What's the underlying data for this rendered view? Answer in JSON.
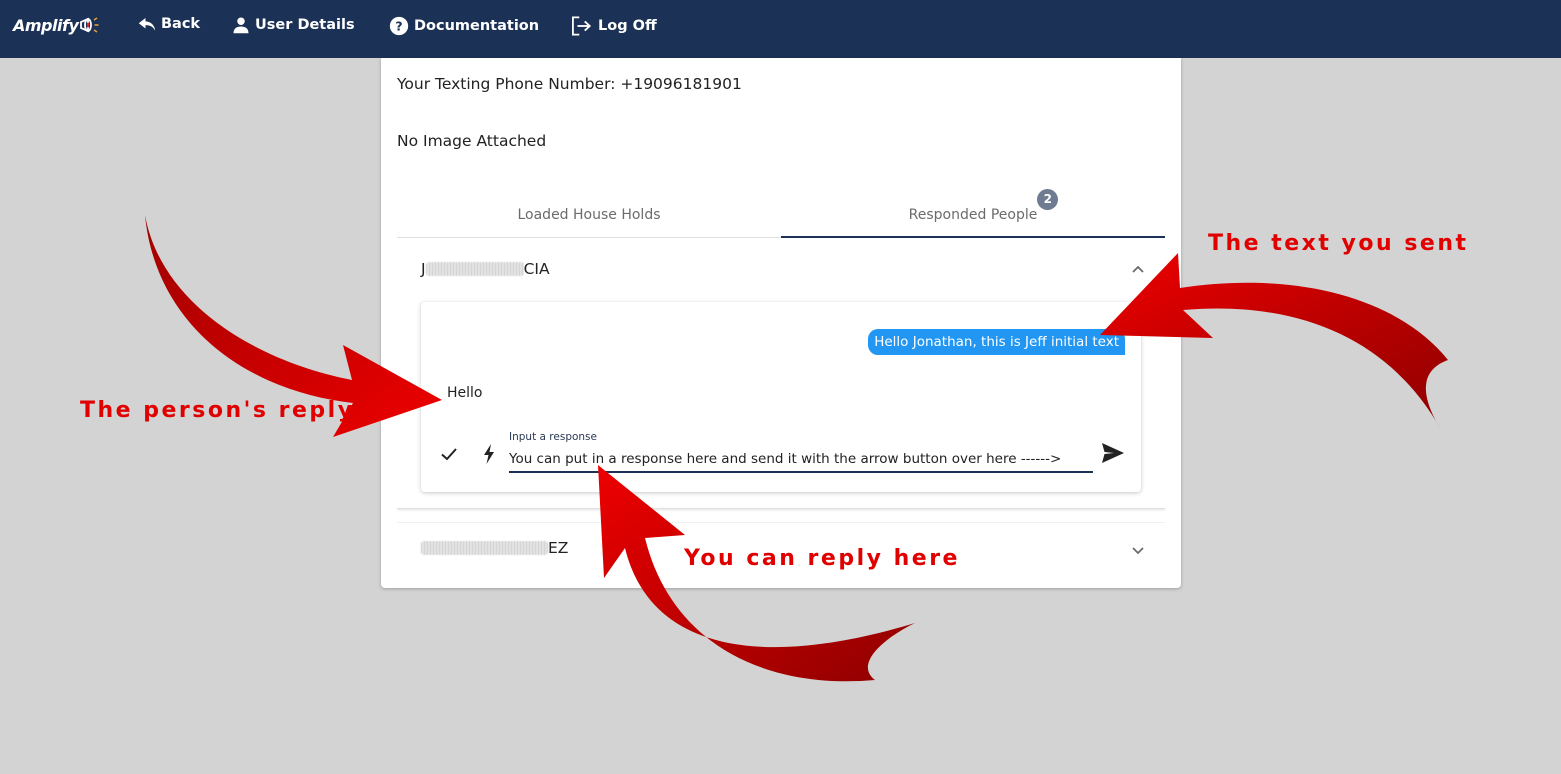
{
  "navbar": {
    "brand": "Amplify",
    "items": [
      {
        "label": "Back",
        "icon": "reply-back-icon"
      },
      {
        "label": "User Details",
        "icon": "person-icon"
      },
      {
        "label": "Documentation",
        "icon": "help-circle-icon"
      },
      {
        "label": "Log Off",
        "icon": "logout-icon"
      }
    ]
  },
  "card": {
    "phone_label": "Your Texting Phone Number: +19096181901",
    "image_status": "No Image Attached",
    "tabs": [
      {
        "label": "Loaded House Holds",
        "active": false
      },
      {
        "label": "Responded People",
        "active": true,
        "badge": "2"
      }
    ],
    "responders": [
      {
        "name_prefix": "J",
        "name_suffix": "CIA",
        "expanded": true,
        "messages": [
          {
            "direction": "sent",
            "text": "Hello Jonathan, this is Jeff initial text"
          },
          {
            "direction": "received",
            "text": "Hello"
          }
        ],
        "response_field": {
          "label": "Input a response",
          "value": "You can put in a response here and send it with the arrow button over here ------>"
        }
      },
      {
        "name_prefix": "",
        "name_suffix": "EZ",
        "expanded": false
      }
    ]
  },
  "annotations": {
    "sent": "The text you sent",
    "reply": "The person's reply",
    "respond": "You can reply here"
  },
  "colors": {
    "navbar": "#1b3156",
    "sent_bubble": "#2196f3",
    "annotation": "#e00000",
    "badge": "#6f7b90"
  }
}
